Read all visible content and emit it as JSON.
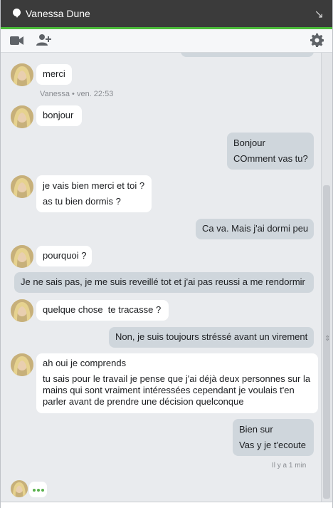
{
  "header": {
    "title": "Vanessa Dune"
  },
  "toolbar": {
    "video_icon": "video-camera-icon",
    "add_person_icon": "add-person-icon",
    "settings_icon": "gear-icon"
  },
  "messages": [
    {
      "dir": "in",
      "lines": [
        "merci"
      ]
    },
    {
      "meta": "Vanessa • ven. 22:53"
    },
    {
      "dir": "in",
      "lines": [
        "bonjour"
      ]
    },
    {
      "dir": "out",
      "lines": [
        "Bonjour",
        "COmment vas tu?"
      ]
    },
    {
      "dir": "in",
      "lines": [
        "je vais bien merci et toi ?",
        "as tu bien dormis ?"
      ]
    },
    {
      "dir": "out",
      "lines": [
        "Ca va. Mais j'ai dormi peu"
      ]
    },
    {
      "dir": "in",
      "lines": [
        "pourquoi ?"
      ]
    },
    {
      "dir": "out",
      "lines": [
        "Je ne sais pas, je me suis reveillé tot et j'ai pas reussi a me rendormir"
      ]
    },
    {
      "dir": "in",
      "lines": [
        "quelque chose  te tracasse ?"
      ]
    },
    {
      "dir": "out",
      "lines": [
        "Non, je suis toujours stréssé avant un virement"
      ]
    },
    {
      "dir": "in",
      "lines": [
        "ah oui je comprends",
        "tu sais pour le travail je pense que j'ai déjà deux personnes sur la mains qui sont vraiment intéressées cependant je voulais t'en parler avant de prendre une décision quelconque"
      ]
    },
    {
      "dir": "out",
      "lines": [
        "Bien sur",
        "Vas y je t'ecoute"
      ]
    },
    {
      "meta": "Il y a 1 min"
    }
  ]
}
